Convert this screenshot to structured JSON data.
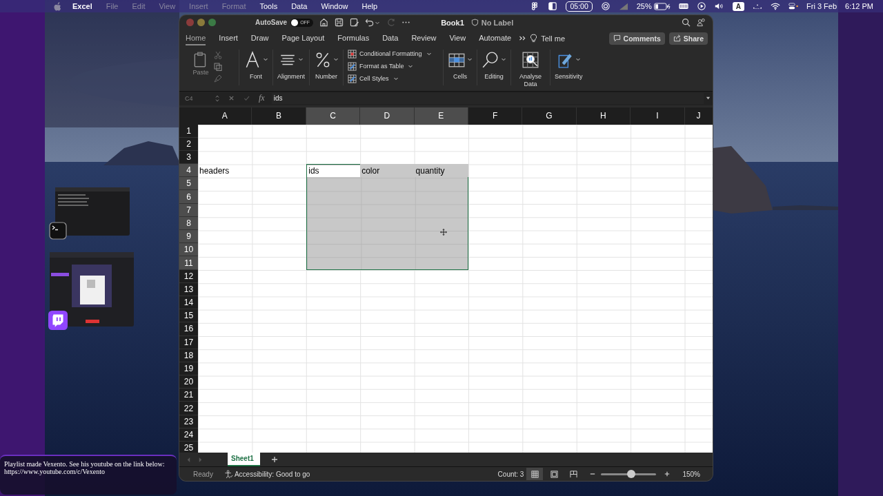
{
  "menu_bar": {
    "menus": [
      "Excel",
      "File",
      "Edit",
      "View",
      "Insert",
      "Format",
      "Tools",
      "Data",
      "Window",
      "Help"
    ],
    "status": {
      "timer": "05:00",
      "battery": "25%",
      "input_source": "A",
      "date": "Fri 3 Feb",
      "time": "6:12 PM"
    }
  },
  "window": {
    "title": "Book1",
    "sensitivity_label": "No Label",
    "autosave": {
      "label": "AutoSave",
      "on": false,
      "state_text": "OFF"
    }
  },
  "ribbon": {
    "tabs": [
      {
        "label": "Home",
        "selected": true
      },
      {
        "label": "Insert",
        "selected": false
      },
      {
        "label": "Draw",
        "selected": false
      },
      {
        "label": "Page Layout",
        "selected": false
      },
      {
        "label": "Formulas",
        "selected": false
      },
      {
        "label": "Data",
        "selected": false
      },
      {
        "label": "Review",
        "selected": false
      },
      {
        "label": "View",
        "selected": false
      },
      {
        "label": "Automate",
        "selected": false
      }
    ],
    "tell_me": "Tell me",
    "buttons": [
      {
        "kind": "comments",
        "label": "Comments"
      },
      {
        "kind": "share",
        "label": "Share"
      }
    ],
    "groups": [
      {
        "kind": "paste",
        "label": "Paste",
        "disabled": true
      },
      {
        "kind": "font",
        "label": "Font"
      },
      {
        "kind": "alignment",
        "label": "Alignment"
      },
      {
        "kind": "number",
        "label": "Number"
      },
      {
        "kind": "styles",
        "items": [
          "Conditional Formatting",
          "Format as Table",
          "Cell Styles"
        ]
      },
      {
        "kind": "cells",
        "label": "Cells"
      },
      {
        "kind": "editing",
        "label": "Editing"
      },
      {
        "kind": "analyse",
        "label": "Analyse Data"
      },
      {
        "kind": "sensitivity",
        "label": "Sensitivity"
      }
    ]
  },
  "formula_bar": {
    "name_box": "C4",
    "function_symbol": "fx",
    "value": "ids"
  },
  "sheet": {
    "columns": [
      {
        "label": "A",
        "selected": false
      },
      {
        "label": "B",
        "selected": false
      },
      {
        "label": "C",
        "selected": true
      },
      {
        "label": "D",
        "selected": true
      },
      {
        "label": "E",
        "selected": true
      },
      {
        "label": "F",
        "selected": false
      },
      {
        "label": "G",
        "selected": false
      },
      {
        "label": "H",
        "selected": false
      },
      {
        "label": "I",
        "selected": false
      },
      {
        "label": "J",
        "selected": false
      }
    ],
    "rows": [
      {
        "label": "1",
        "selected": false
      },
      {
        "label": "2",
        "selected": false
      },
      {
        "label": "3",
        "selected": false
      },
      {
        "label": "4",
        "selected": true,
        "values": {
          "A": "headers",
          "C": "ids",
          "D": "color",
          "E": "quantity"
        }
      },
      {
        "label": "5",
        "selected": true
      },
      {
        "label": "6",
        "selected": true
      },
      {
        "label": "7",
        "selected": true
      },
      {
        "label": "8",
        "selected": true
      },
      {
        "label": "9",
        "selected": true
      },
      {
        "label": "10",
        "selected": true
      },
      {
        "label": "11",
        "selected": true
      },
      {
        "label": "12",
        "selected": false
      },
      {
        "label": "13",
        "selected": false
      },
      {
        "label": "14",
        "selected": false
      },
      {
        "label": "15",
        "selected": false
      },
      {
        "label": "16",
        "selected": false
      },
      {
        "label": "17",
        "selected": false
      },
      {
        "label": "18",
        "selected": false
      },
      {
        "label": "19",
        "selected": false
      },
      {
        "label": "20",
        "selected": false
      },
      {
        "label": "21",
        "selected": false
      },
      {
        "label": "22",
        "selected": false
      },
      {
        "label": "23",
        "selected": false
      },
      {
        "label": "24",
        "selected": false
      },
      {
        "label": "25",
        "selected": false
      }
    ]
  },
  "sheet_tabs": [
    {
      "label": "Sheet1",
      "selected": true
    }
  ],
  "status_bar": {
    "mode": "Ready",
    "accessibility": "Accessibility: Good to go",
    "count": "Count: 3",
    "views": [
      {
        "kind": "normal",
        "selected": true
      },
      {
        "kind": "page_layout",
        "selected": false
      },
      {
        "kind": "page_break",
        "selected": false
      }
    ],
    "zoom": {
      "level": 0.55,
      "reading": "150%"
    }
  },
  "caption": {
    "text": "Playlist made Vexento. See his youtube on the link below:",
    "link": "https://www.youtube.com/c/Vexento"
  }
}
